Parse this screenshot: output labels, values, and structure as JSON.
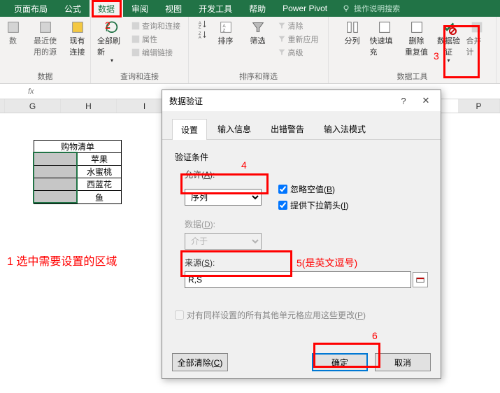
{
  "ribbon_tabs": {
    "page_layout": "页面布局",
    "formulas": "公式",
    "data": "数据",
    "review": "审阅",
    "view": "视图",
    "developer": "开发工具",
    "help": "帮助",
    "power_pivot": "Power Pivot",
    "search_hint": "操作说明搜索"
  },
  "ribbon_groups": {
    "recent_sources": "最近使\n用的源",
    "existing_conn": "现有\n连接",
    "refresh_all": "全部刷新",
    "queries_connections": "查询和连接",
    "properties": "属性",
    "edit_links": "编辑链接",
    "sort": "排序",
    "filter": "筛选",
    "clear": "清除",
    "reapply": "重新应用",
    "advanced": "高级",
    "text_to_columns": "分列",
    "flash_fill": "快速填充",
    "remove_dup": "删除\n重复值",
    "data_validation": "数据验\n证",
    "consolidate": "合并计",
    "g_data": "数据",
    "g_queries": "查询和连接",
    "g_sort_filter": "排序和筛选",
    "g_data_tools": "数据工具"
  },
  "formula_bar": {
    "fx": "fx"
  },
  "columns": {
    "g": "G",
    "h": "H",
    "i": "I",
    "p": "P"
  },
  "shopping": {
    "title": "购物清单",
    "apple": "苹果",
    "peach": "水蜜桃",
    "broccoli": "西蓝花",
    "fish": "鱼"
  },
  "dialog": {
    "title": "数据验证",
    "tab_settings": "设置",
    "tab_input": "输入信息",
    "tab_error": "出错警告",
    "tab_ime": "输入法模式",
    "validation_condition": "验证条件",
    "allow_label": "允许(A):",
    "allow_value": "序列",
    "ignore_blank": "忽略空值(B)",
    "dropdown_arrow": "提供下拉箭头(I)",
    "data_label": "数据(D):",
    "data_value": "介于",
    "source_label": "来源(S):",
    "source_value": "R,S",
    "apply_all": "对有同样设置的所有其他单元格应用这些更改(P)",
    "clear_all": "全部清除(C)",
    "ok": "确定",
    "cancel": "取消"
  },
  "annotations": {
    "a1": "1 选中需要设置的区域",
    "a2": "2",
    "a3": "3",
    "a4": "4",
    "a5": "5(是英文逗号)",
    "a6": "6"
  }
}
